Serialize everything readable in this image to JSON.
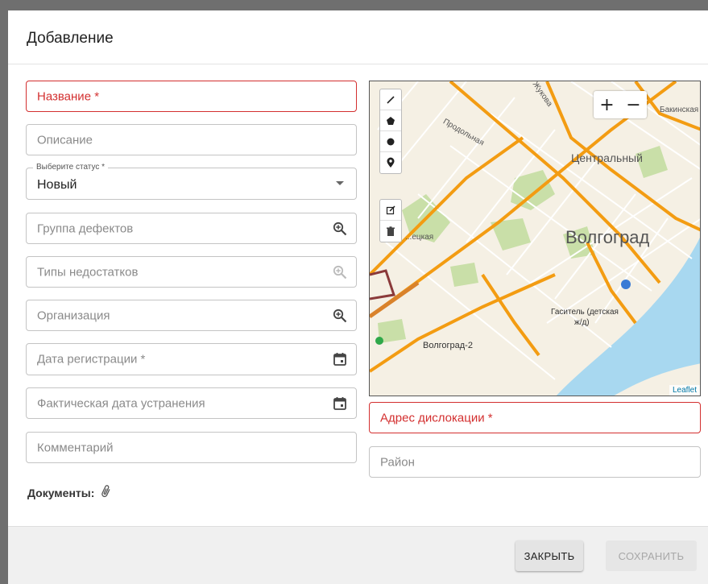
{
  "dialog": {
    "title": "Добавление"
  },
  "form": {
    "name_placeholder": "Название *",
    "description_placeholder": "Описание",
    "status_legend": "Выберите статус *",
    "status_value": "Новый",
    "defect_group_placeholder": "Группа дефектов",
    "deficiency_types_placeholder": "Типы недостатков",
    "organization_placeholder": "Организация",
    "registration_date_placeholder": "Дата регистрации *",
    "actual_fix_date_placeholder": "Фактическая дата устранения",
    "comment_placeholder": "Комментарий",
    "documents_label": "Документы:",
    "address_placeholder": "Адрес дислокации *",
    "district_placeholder": "Район"
  },
  "map": {
    "labels": {
      "street_zhukova": "... Жукова",
      "bakinskaya": "Бакинская",
      "prodolnaya": "Продольная",
      "tsentralny": "Центральный",
      "volgograd": "Волгоград",
      "gasitel": "Гаситель (детская",
      "gasitel_2": "ж/д)",
      "volgograd_2": "Волгоград-2",
      "street_left": "...ецкая"
    },
    "zoom_in": "+",
    "zoom_out": "−",
    "attribution": "Leaflet"
  },
  "footer": {
    "close_label": "ЗАКРЫТЬ",
    "save_label": "СОХРАНИТЬ"
  },
  "icons": {
    "zoom_search": "magnify-plus-icon",
    "calendar": "calendar-icon",
    "dropdown": "caret-down-icon",
    "attach": "paperclip-icon"
  },
  "colors": {
    "error": "#d32f2f",
    "water": "#a8d8f0",
    "road": "#f39c12"
  }
}
